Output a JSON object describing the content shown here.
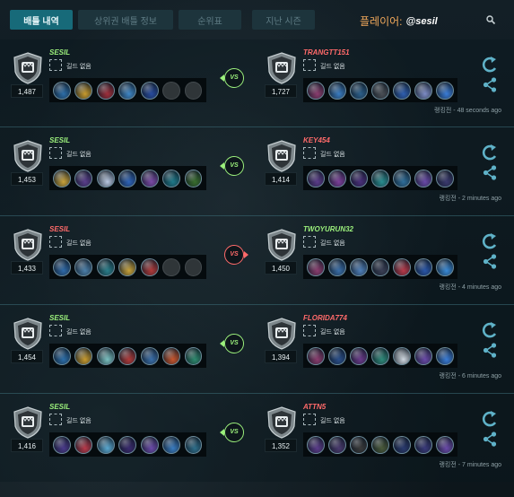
{
  "tabs": [
    {
      "label": "배틀 내역",
      "active": true
    },
    {
      "label": "상위권 배틀 정보",
      "active": false
    },
    {
      "label": "순위표",
      "active": false
    },
    {
      "label": "지난 시즌",
      "active": false
    }
  ],
  "player": {
    "label": "플레이어:",
    "handle": "@sesil"
  },
  "guild_label": "길드 없음",
  "colors": {
    "win": "#9bf07c",
    "lose": "#ff6a6a",
    "accent": "#176a79",
    "player_label": "#f1a85b"
  },
  "icons": {
    "search": "search-icon",
    "refresh": "refresh-icon",
    "share": "share-icon",
    "rank": "shield-icon"
  },
  "matches": [
    {
      "left": {
        "name": "SESIL",
        "rating": "1,487",
        "result": "win",
        "heroes": [
          "#2d6ea8",
          "#c79a2e",
          "#9e2f3b",
          "#3f86c4",
          "#284c9e",
          "empty",
          "empty"
        ]
      },
      "vs": "VS",
      "vs_result": "win",
      "right": {
        "name": "TRANGTT151",
        "rating": "1,727",
        "result": "lose",
        "heroes": [
          "#8a3d6e",
          "#3a7cc0",
          "#2c5f8a",
          "#4a4f55",
          "#2f5fb0",
          "#7d8cc4",
          "#3a7cd6"
        ]
      },
      "time": "랭킹전 - 48 seconds ago"
    },
    {
      "left": {
        "name": "SESIL",
        "rating": "1,453",
        "result": "win",
        "heroes": [
          "#c9a23a",
          "#5a3e8c",
          "#b8c7e0",
          "#2f64b8",
          "#7b4aa6",
          "#1f7a8a",
          "#3a6e2e"
        ]
      },
      "vs": "VS",
      "vs_result": "win",
      "right": {
        "name": "KEY454",
        "rating": "1,414",
        "result": "lose",
        "heroes": [
          "#5b3c8a",
          "#7c3f9a",
          "#4a2f7a",
          "#2a8d8f",
          "#2f6e9a",
          "#6a4aa8",
          "#3b3a6e"
        ]
      },
      "time": "랭킹전 - 2 minutes ago"
    },
    {
      "left": {
        "name": "SESIL",
        "rating": "1,433",
        "result": "lose",
        "heroes": [
          "#2f6aa8",
          "#4c7fa8",
          "#2a7e8a",
          "#c7a23a",
          "#b03a3a",
          "empty",
          "empty"
        ]
      },
      "vs": "VS",
      "vs_result": "lose",
      "right": {
        "name": "TWOYURUN32",
        "rating": "1,450",
        "result": "win",
        "heroes": [
          "#8a3d6e",
          "#3a6ea8",
          "#4f7fb8",
          "#3a3f55",
          "#b83a4a",
          "#2a56a8",
          "#3a8ad6"
        ]
      },
      "time": "랭킹전 - 4 minutes ago"
    },
    {
      "left": {
        "name": "SESIL",
        "rating": "1,454",
        "result": "win",
        "heroes": [
          "#2d6ea8",
          "#c79a2e",
          "#7ac0c0",
          "#b03a3a",
          "#3a6ea8",
          "#c7562e",
          "#2f8a6e"
        ]
      },
      "vs": "VS",
      "vs_result": "win",
      "right": {
        "name": "FLORIDA774",
        "rating": "1,394",
        "result": "lose",
        "heroes": [
          "#8a3d6e",
          "#2a4f8a",
          "#6a3a8a",
          "#2f8a7a",
          "#d0d8e0",
          "#6a4aa8",
          "#3a7cd6"
        ]
      },
      "time": "랭킹전 - 6 minutes ago"
    },
    {
      "left": {
        "name": "SESIL",
        "rating": "1,416",
        "result": "win",
        "heroes": [
          "#4a3a8a",
          "#b83a4a",
          "#5aa8d0",
          "#3a2a6e",
          "#6a4aa8",
          "#3a7cc0",
          "#2f6e8a"
        ]
      },
      "vs": "VS",
      "vs_result": "win",
      "right": {
        "name": "ATTN5",
        "rating": "1,352",
        "result": "lose",
        "heroes": [
          "#5b3c8a",
          "#4a3a6e",
          "#3a3a3a",
          "#4a5a3a",
          "#2a3a6e",
          "#3a3a7a",
          "#6a4aa8"
        ]
      },
      "time": "랭킹전 - 7 minutes ago"
    }
  ]
}
